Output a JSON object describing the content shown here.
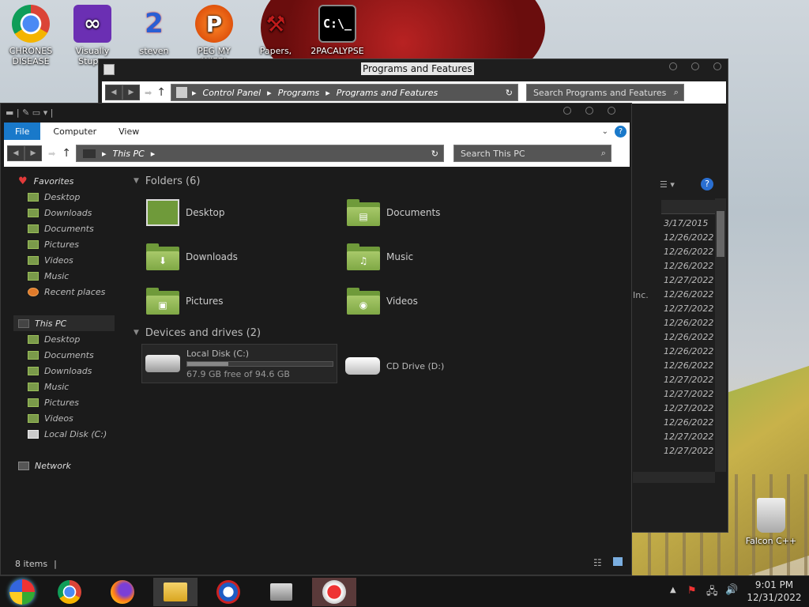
{
  "desktop": {
    "icons": [
      {
        "label": "CHRONES DISEASE",
        "icon": "chrome-icon"
      },
      {
        "label": "Visually Stup...",
        "icon": "visual-studio-icon"
      },
      {
        "label": "steven",
        "icon": "steven-icon"
      },
      {
        "label": "PEG MY WIFE!",
        "icon": "peg-icon"
      },
      {
        "label": "Papers,",
        "icon": "papers-icon"
      },
      {
        "label": "2PACALYPSE",
        "icon": "cmd-icon"
      }
    ],
    "recycle_bin_label": "Falcon C++"
  },
  "programs_window": {
    "title": "Programs and Features",
    "breadcrumb": [
      "Control Panel",
      "Programs",
      "Programs and Features"
    ],
    "search_placeholder": "Search Programs and Features",
    "partial_text": "Inc.",
    "dates": [
      "3/17/2015",
      "12/26/2022",
      "12/26/2022",
      "12/26/2022",
      "12/27/2022",
      "12/26/2022",
      "12/27/2022",
      "12/26/2022",
      "12/26/2022",
      "12/26/2022",
      "12/26/2022",
      "12/27/2022",
      "12/27/2022",
      "12/27/2022",
      "12/26/2022",
      "12/27/2022",
      "12/27/2022"
    ]
  },
  "explorer": {
    "ribbon_tabs": [
      "File",
      "Computer",
      "View"
    ],
    "breadcrumb": "This PC",
    "search_placeholder": "Search This PC",
    "sidebar": {
      "favorites_label": "Favorites",
      "favorites": [
        "Desktop",
        "Downloads",
        "Documents",
        "Pictures",
        "Videos",
        "Music",
        "Recent places"
      ],
      "this_pc_label": "This PC",
      "this_pc": [
        "Desktop",
        "Documents",
        "Downloads",
        "Music",
        "Pictures",
        "Videos",
        "Local Disk (C:)"
      ],
      "network_label": "Network"
    },
    "folders_header": "Folders (6)",
    "folders": [
      "Desktop",
      "Documents",
      "Downloads",
      "Music",
      "Pictures",
      "Videos"
    ],
    "drives_header": "Devices and drives (2)",
    "local_disk": {
      "name": "Local Disk (C:)",
      "free_text": "67.9 GB free of 94.6 GB",
      "used_fraction": 0.28
    },
    "cd_drive": "CD Drive (D:)",
    "status": "8 items"
  },
  "taskbar": {
    "time": "9:01 PM",
    "date": "12/31/2022",
    "apps": [
      "windows-start-icon",
      "chrome-icon",
      "firefox-icon",
      "file-explorer-icon",
      "obama-icon",
      "cash-register-icon",
      "game-icon"
    ]
  }
}
